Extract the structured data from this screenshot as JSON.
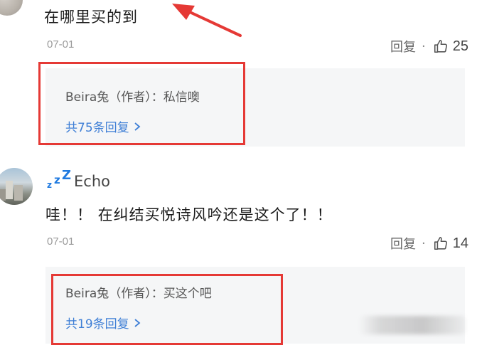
{
  "comment1": {
    "text": "在哪里买的到",
    "date": "07-01",
    "reply_label": "回复",
    "dot": "·",
    "likes": "25",
    "reply_preview": {
      "author": "Beira兔（作者）",
      "separator": "：",
      "text": "私信噢",
      "more": "共75条回复"
    }
  },
  "comment2": {
    "zzz": [
      "z",
      "z",
      "Z"
    ],
    "username": "Echo",
    "text": "哇！！ 在纠结买悦诗风吟还是这个了！！",
    "date": "07-01",
    "reply_label": "回复",
    "dot": "·",
    "likes": "14",
    "reply_preview": {
      "author": "Beira兔（作者）",
      "separator": "：",
      "text": "买这个吧",
      "more": "共19条回复"
    }
  },
  "colors": {
    "annotation_red": "#e53935",
    "link_blue": "#3f7fd6",
    "reply_bg": "#f5f6f7"
  },
  "icons": [
    "thumbs-up-icon",
    "chevron-right-icon",
    "arrow-annotation",
    "avatar"
  ]
}
